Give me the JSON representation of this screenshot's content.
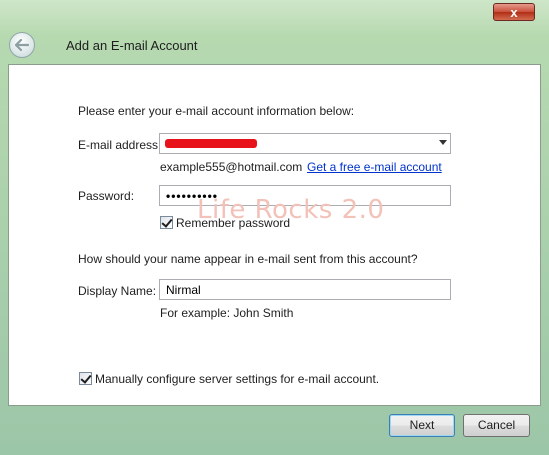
{
  "window": {
    "title": "Add an E-mail Account",
    "close_label": "x"
  },
  "form": {
    "intro": "Please enter your e-mail account information below:",
    "email_label": "E-mail address:",
    "email_hint": "example555@hotmail.com",
    "free_account_link": "Get a free e-mail account",
    "password_label": "Password:",
    "password_value": "••••••••••",
    "remember_label": "Remember password",
    "remember_checked": true,
    "name_question": "How should your name appear in e-mail sent from this account?",
    "display_name_label": "Display Name:",
    "display_name_value": "Nirmal",
    "display_name_example": "For example: John Smith",
    "manual_config_label": "Manually configure server settings for e-mail account.",
    "manual_config_checked": true
  },
  "watermark": "Life Rocks 2.0",
  "footer": {
    "next_label": "Next",
    "cancel_label": "Cancel"
  },
  "colors": {
    "link": "#0033cc",
    "redaction": "#e8121b",
    "glass": "#b6d9b0"
  }
}
